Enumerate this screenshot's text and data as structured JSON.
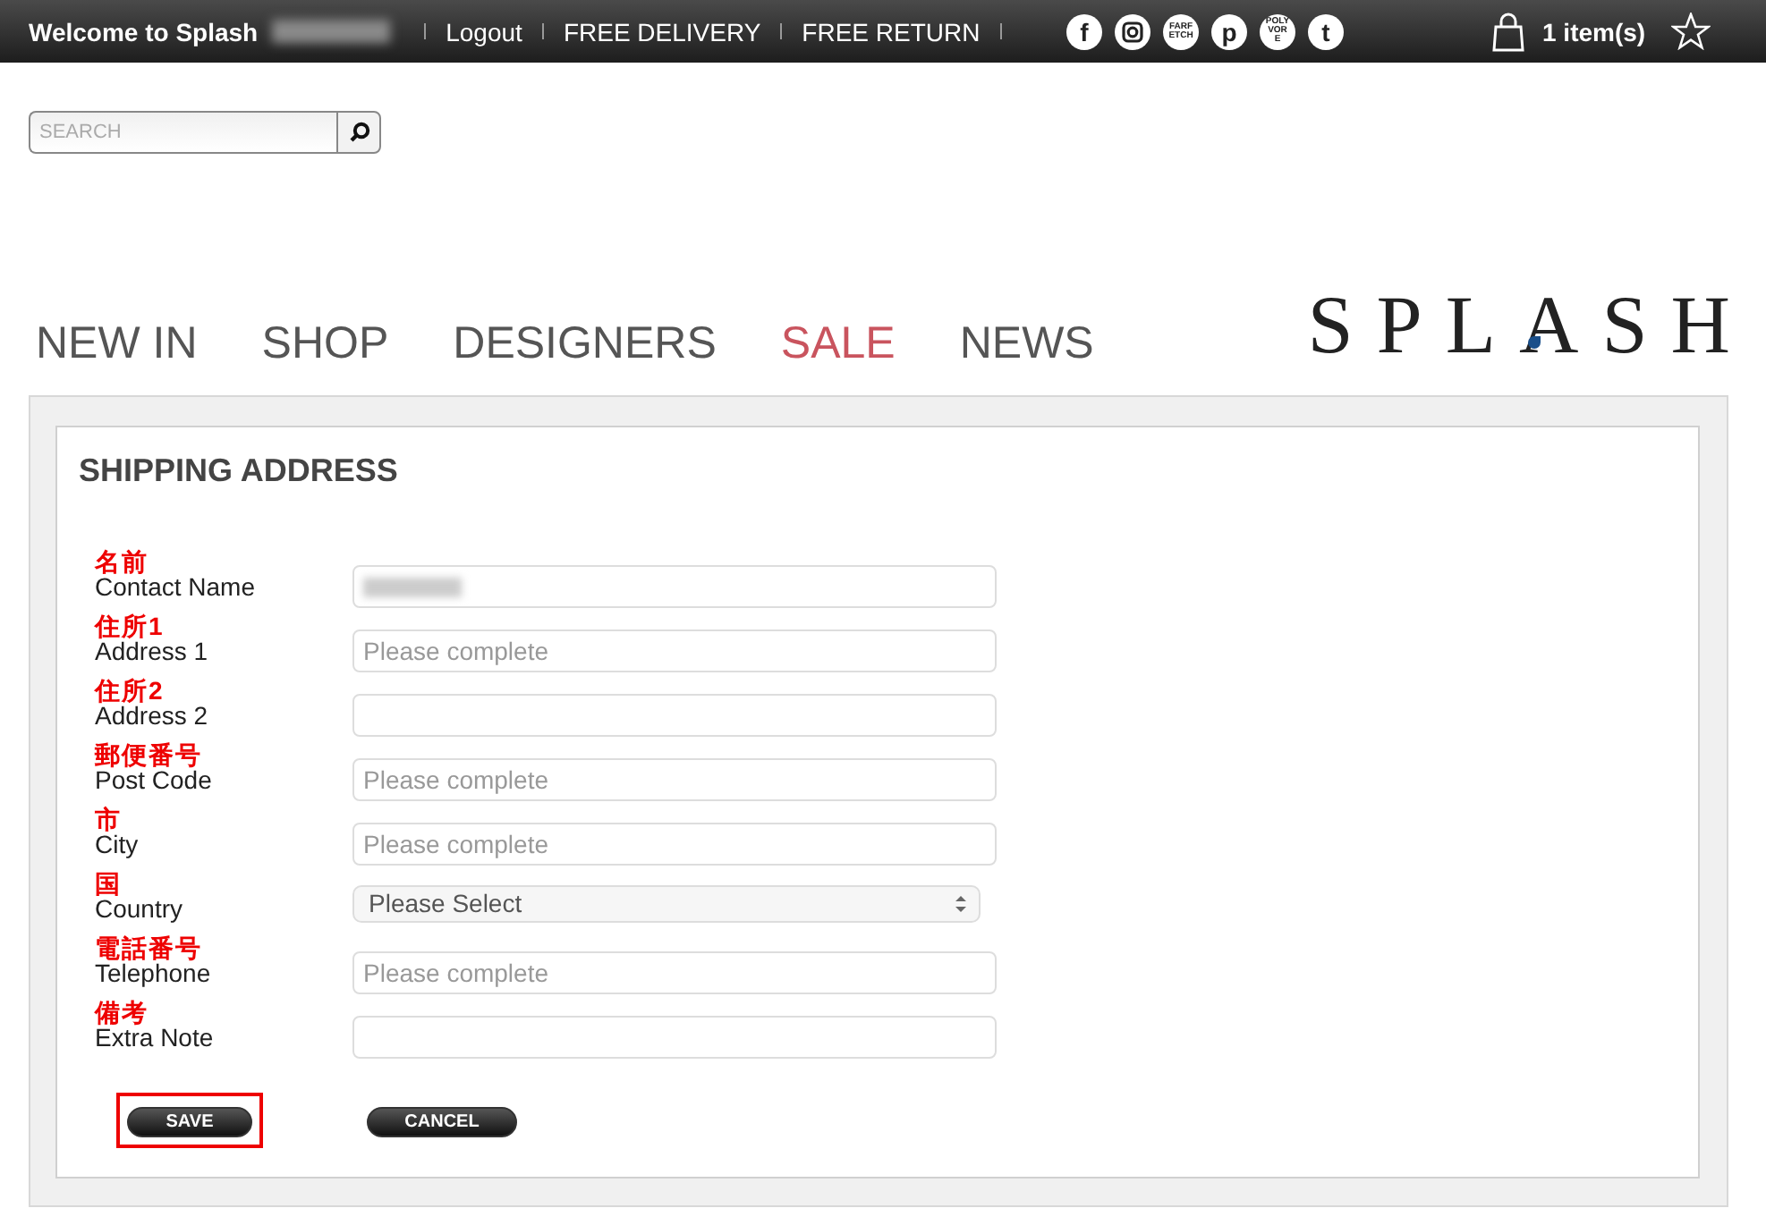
{
  "top_bar": {
    "welcome": "Welcome to Splash",
    "user_redacted": true,
    "links": [
      "Logout",
      "FREE DELIVERY",
      "FREE RETURN"
    ],
    "social": [
      {
        "kind": "letter",
        "label": "f"
      },
      {
        "kind": "camera"
      },
      {
        "kind": "letter",
        "label": "FARF ETCH"
      },
      {
        "kind": "letter",
        "label": "p"
      },
      {
        "kind": "letter",
        "label": "POLY VORE"
      },
      {
        "kind": "letter",
        "label": "t"
      }
    ],
    "cart": "1 item(s)"
  },
  "search": {
    "placeholder": "SEARCH"
  },
  "nav": [
    {
      "label": "NEW IN",
      "kind": "normal"
    },
    {
      "label": "SHOP",
      "kind": "normal"
    },
    {
      "label": "DESIGNERS",
      "kind": "normal"
    },
    {
      "label": "SALE",
      "kind": "sale"
    },
    {
      "label": "NEWS",
      "kind": "normal"
    }
  ],
  "logo": "SPLASH",
  "form": {
    "title": "SHIPPING ADDRESS",
    "fields": [
      {
        "note": "名前",
        "label": "Contact Name",
        "kind": "text",
        "value_redacted": true
      },
      {
        "note": "住所1",
        "label": "Address 1",
        "kind": "text",
        "placeholder": "Please complete"
      },
      {
        "note": "住所2",
        "label": "Address 2",
        "kind": "text"
      },
      {
        "note": "郵便番号",
        "label": "Post Code",
        "kind": "text",
        "placeholder": "Please complete"
      },
      {
        "note": "市",
        "label": "City",
        "kind": "text",
        "placeholder": "Please complete"
      },
      {
        "note": "国",
        "label": "Country",
        "kind": "select",
        "value": "Please Select"
      },
      {
        "note": "電話番号",
        "label": "Telephone",
        "kind": "text",
        "placeholder": "Please complete"
      },
      {
        "note": "備考",
        "label": "Extra Note",
        "kind": "text"
      }
    ],
    "buttons": [
      {
        "label": "SAVE",
        "highlighted": true
      },
      {
        "label": "CANCEL",
        "highlighted": false
      }
    ]
  }
}
